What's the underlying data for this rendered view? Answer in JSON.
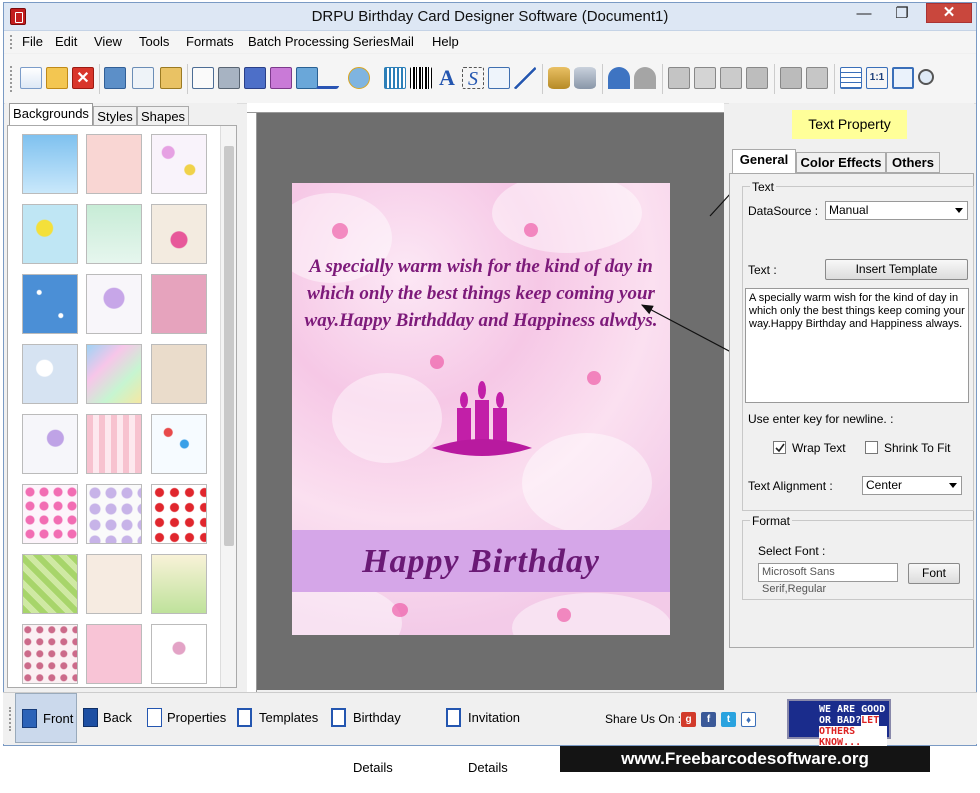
{
  "window": {
    "title": "DRPU Birthday Card Designer Software (Document1)",
    "min": "—",
    "max": "❐",
    "close": "✕"
  },
  "menu": [
    "File",
    "Edit",
    "View",
    "Tools",
    "Formats",
    "Batch Processing Series",
    "Mail",
    "Help"
  ],
  "toolbar_icons": [
    "new-icon",
    "open-icon",
    "close-icon",
    "save-icon",
    "save-as-icon",
    "export-icon",
    "print-preview-icon",
    "print-icon",
    "print-copies-icon",
    "layers-icon",
    "image-icon",
    "pencil-icon",
    "image-edit-icon",
    "watermark-icon",
    "barcode-icon",
    "text-icon",
    "signature-icon",
    "mail-icon",
    "line-icon",
    "database-icon",
    "database-list-icon",
    "undo-icon",
    "redo-icon",
    "cut-icon",
    "copy-icon",
    "paste-icon",
    "delete-icon",
    "bring-front-icon",
    "send-back-icon",
    "grid-icon",
    "actual-size-icon",
    "fit-icon",
    "zoom-icon"
  ],
  "left_tabs": [
    "Backgrounds",
    "Styles",
    "Shapes"
  ],
  "card": {
    "message": "A specially warm wish for the kind of day in which only the best things keep coming your way.Happy Birthdday and Happiness alwdys.",
    "title": "Happy Birthday"
  },
  "right": {
    "badge": "Text Property",
    "tabs": [
      "General",
      "Color Effects",
      "Others"
    ],
    "text_group": "Text",
    "datasource_label": "DataSource :",
    "datasource_value": "Manual",
    "text_label": "Text :",
    "insert_template": "Insert Template",
    "textarea": "A specially warm wish for the kind of day in which only the best things keep coming your way.Happy Birthday and Happiness always.",
    "newline_hint": "Use enter key for newline. :",
    "wrap_text": "Wrap Text",
    "shrink_fit": "Shrink To Fit",
    "align_label": "Text Alignment :",
    "align_value": "Center",
    "format_group": "Format",
    "select_font": "Select Font :",
    "font_value": "Microsoft Sans Serif,Regular",
    "font_button": "Font"
  },
  "bottom": {
    "buttons": [
      "Front",
      "Back",
      "Properties",
      "Templates",
      "Birthday Details",
      "Invitation Details"
    ],
    "share": "Share Us On :",
    "goodbad_line1": "WE ARE GOOD",
    "goodbad_line2": "OR BAD?",
    "goodbad_let": "LET",
    "goodbad_line3": "OTHERS KNOW..."
  },
  "watermark": "www.Freebarcodesoftware.org",
  "colors": {
    "card_text": "#7d1a7a",
    "badge": "#ffff99",
    "canvas_bg": "#6e6e6e"
  }
}
